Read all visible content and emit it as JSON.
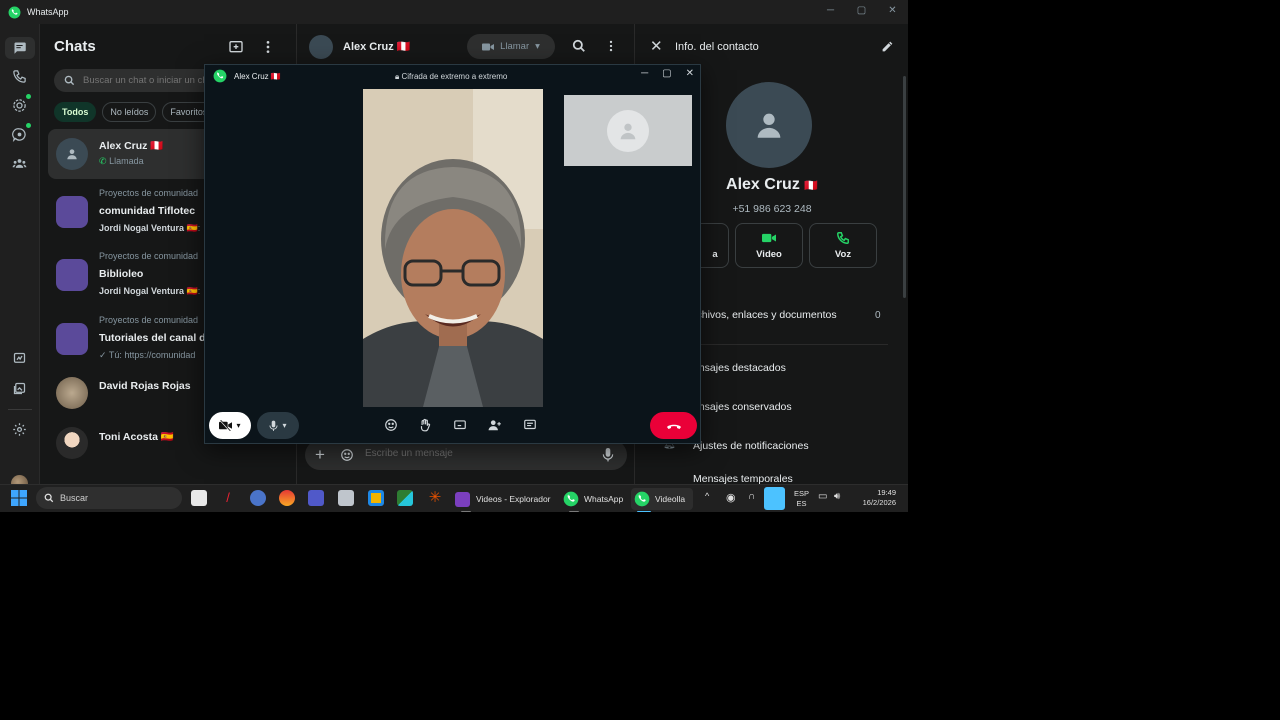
{
  "window": {
    "title": "WhatsApp",
    "ctrl_min": "─",
    "ctrl_max": "▢",
    "ctrl_close": "✕"
  },
  "chat_list": {
    "title": "Chats",
    "search_placeholder": "Buscar un chat o iniciar un chat nuevo",
    "filters": [
      "Todos",
      "No leídos",
      "Favoritos"
    ],
    "items": [
      {
        "name": "Alex Cruz",
        "flag": "🇵🇪",
        "sub": "Llamada"
      },
      {
        "community": "Proyectos de comunidad",
        "name": "comunidad Tiflotec",
        "sender": "Jordi Nogal Ventura",
        "flag": "🇪🇸",
        "sub": ":"
      },
      {
        "community": "Proyectos de comunidad",
        "name": "Biblioleo",
        "sender": "Jordi Nogal Ventura",
        "flag": "🇪🇸",
        "sub": ":"
      },
      {
        "community": "Proyectos de comunidad",
        "name": "Tutoriales del canal de",
        "sub": "Tú: https://comunidad"
      },
      {
        "name": "David Rojas Rojas"
      },
      {
        "name": "Toni Acosta",
        "flag": "🇪🇸"
      }
    ]
  },
  "conversation": {
    "contact": "Alex Cruz",
    "flag": "🇵🇪",
    "call_label": "Llamar",
    "composer_placeholder": "Escribe un mensaje"
  },
  "contact_info": {
    "title": "Info. del contacto",
    "name": "Alex Cruz",
    "flag": "🇵🇪",
    "phone": "+51 986 623 248",
    "actions": [
      "a",
      "Video",
      "Voz"
    ],
    "media_label": "rchivos, enlaces y documentos",
    "media_count": "0",
    "rows": [
      "ensajes destacados",
      "ensajes conservados",
      "Ajustes de notificaciones",
      "Mensajes temporales"
    ]
  },
  "call": {
    "title": "Alex Cruz",
    "flag": "🇵🇪",
    "encryption": "Cifrada de extremo a extremo"
  },
  "taskbar": {
    "search": "Buscar",
    "apps": [
      "Videos - Explorador",
      "WhatsApp",
      "Videolla"
    ],
    "lang": "ESP",
    "lang2": "ES",
    "time": "19:49",
    "date": "16/2/2026"
  },
  "colors": {
    "accent": "#25d366",
    "end_call": "#ea0038",
    "chip_active": "#103529"
  }
}
